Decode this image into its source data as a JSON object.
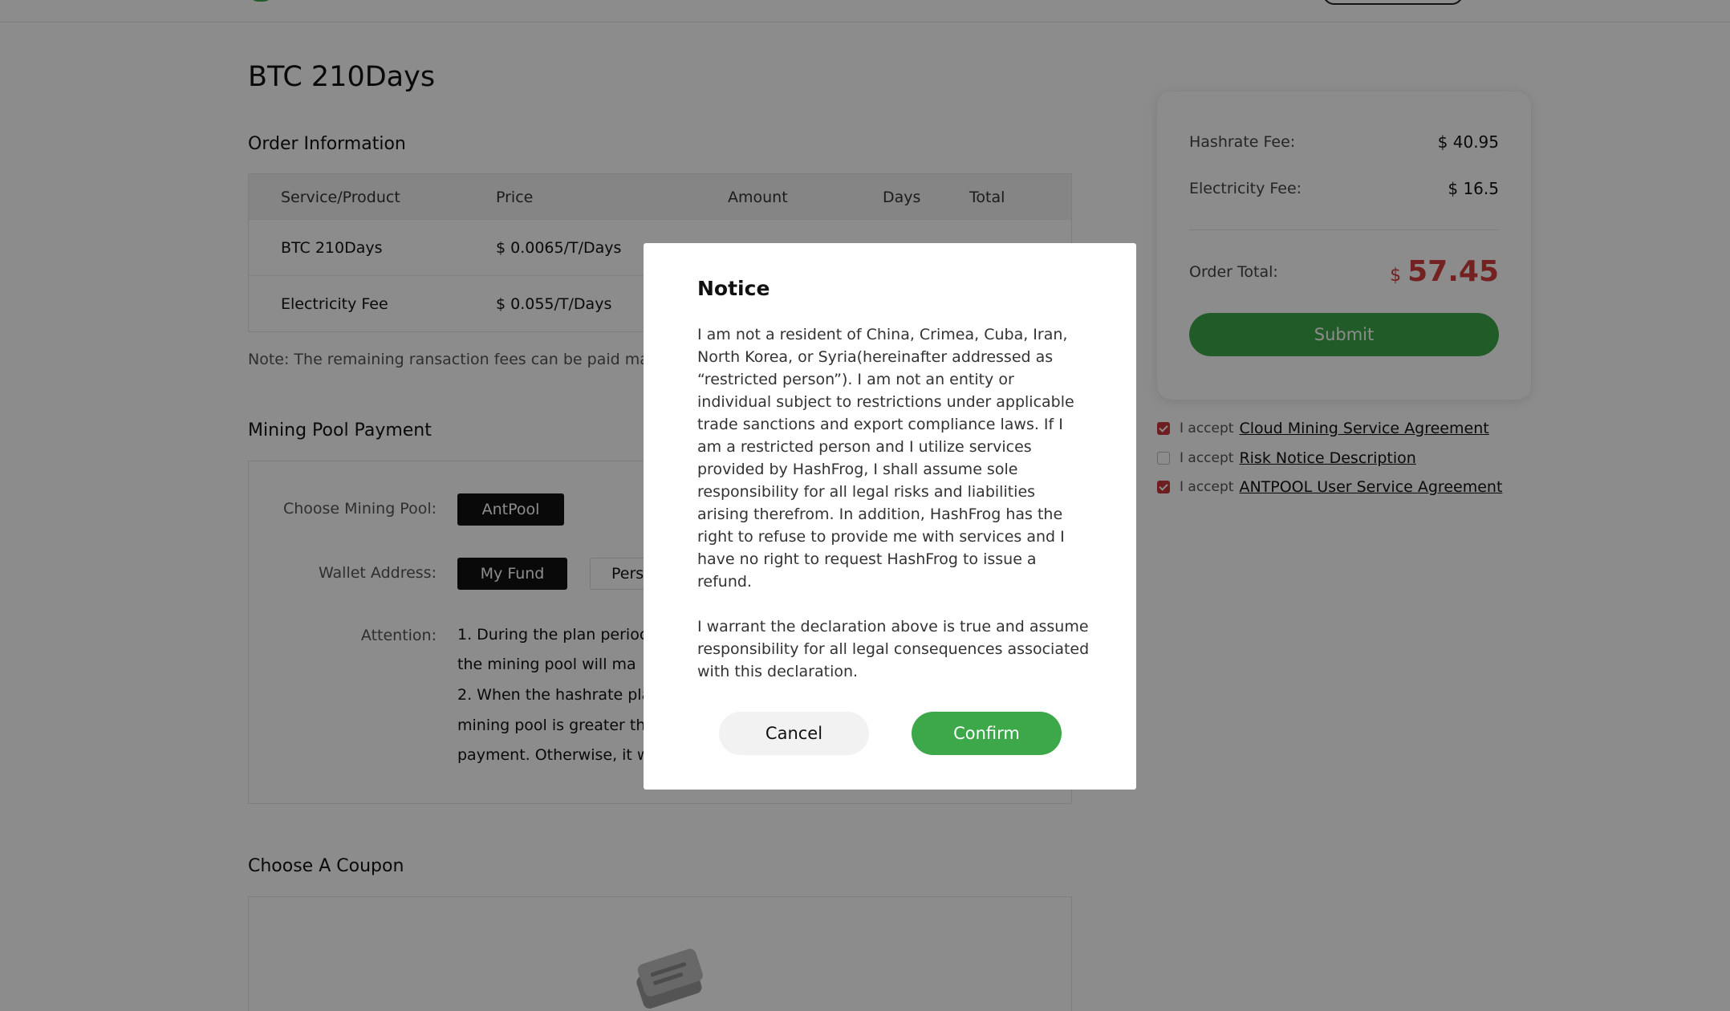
{
  "page": {
    "title": "BTC 210Days"
  },
  "order": {
    "section_title": "Order Information",
    "columns": [
      "Service/Product",
      "Price",
      "Amount",
      "Days",
      "Total"
    ],
    "rows": [
      {
        "product": "BTC 210Days",
        "price": "$ 0.0065/T/Days"
      },
      {
        "product": "Electricity Fee",
        "price": "$ 0.055/T/Days"
      }
    ],
    "note": "Note: The remaining ransaction fees can be paid ma"
  },
  "mining_pool": {
    "section_title": "Mining Pool Payment",
    "choose_label": "Choose Mining Pool:",
    "pool_selected": "AntPool",
    "wallet_label": "Wallet Address:",
    "wallet_options": [
      "My Fund",
      "Pers"
    ],
    "attention_label": "Attention:",
    "attention_lines": [
      "1. During the plan perioc",
      "the mining pool will ma",
      "2. When the hashrate pla",
      "mining pool is greater th",
      "payment. Otherwise, it w"
    ]
  },
  "coupon": {
    "section_title": "Choose A Coupon",
    "icon": "coupon-ticket-icon"
  },
  "summary": {
    "hashrate_fee_label": "Hashrate Fee:",
    "hashrate_fee_value": "$ 40.95",
    "electricity_fee_label": "Electricity Fee:",
    "electricity_fee_value": "$ 16.5",
    "order_total_label": "Order Total:",
    "order_total_currency": "$",
    "order_total_value": "57.45",
    "submit_label": "Submit"
  },
  "agreements": [
    {
      "prefix": "I accept",
      "link": "Cloud Mining Service Agreement",
      "checked": true
    },
    {
      "prefix": "I accept",
      "link": "Risk Notice Description",
      "checked": false
    },
    {
      "prefix": "I accept",
      "link": "ANTPOOL User Service Agreement",
      "checked": true
    }
  ],
  "modal": {
    "title": "Notice",
    "paragraph_1": "I am not a resident of China, Crimea, Cuba, Iran, North Korea, or Syria(hereinafter addressed as “restricted person”). I am not an entity or individual subject to restrictions under applicable trade sanctions and export compliance laws. If I am a restricted person and I utilize services provided by HashFrog, I shall assume sole responsibility for all legal risks and liabilities arising therefrom. In addition, HashFrog has the right to refuse to provide me with services and I have no right to request HashFrog to issue a refund.",
    "paragraph_2": "I warrant the declaration above is true and assume responsibility for all legal consequences associated with this declaration.",
    "cancel_label": "Cancel",
    "confirm_label": "Confirm"
  },
  "colors": {
    "accent_green": "#3da84a",
    "total_red": "#d13d3d",
    "checkbox_red": "#c9363c",
    "overlay": "rgba(0,0,0,0.45)"
  }
}
